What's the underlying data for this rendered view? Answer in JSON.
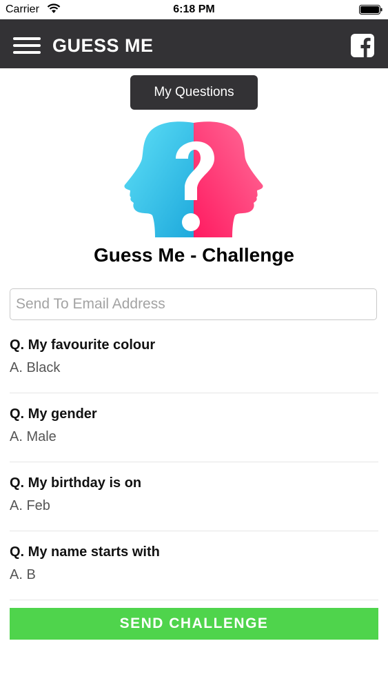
{
  "status_bar": {
    "carrier": "Carrier",
    "time": "6:18 PM"
  },
  "nav": {
    "title": "GUESS ME"
  },
  "my_questions_label": "My Questions",
  "page_title": "Guess Me - Challenge",
  "email": {
    "placeholder": "Send To Email Address",
    "value": ""
  },
  "questions": [
    {
      "question": "Q. My favourite colour",
      "answer": "A. Black"
    },
    {
      "question": "Q. My gender",
      "answer": "A. Male"
    },
    {
      "question": "Q. My birthday is on",
      "answer": "A. Feb"
    },
    {
      "question": "Q. My name starts with",
      "answer": "A. B"
    }
  ],
  "send_label": "SEND CHALLENGE",
  "colors": {
    "nav_bg": "#333235",
    "send_button": "#4fd44c",
    "logo_blue": "#3cc8ea",
    "logo_pink": "#ff2e72"
  },
  "icons": [
    "wifi-icon",
    "battery-icon",
    "menu-icon",
    "facebook-icon",
    "guess-me-logo"
  ]
}
